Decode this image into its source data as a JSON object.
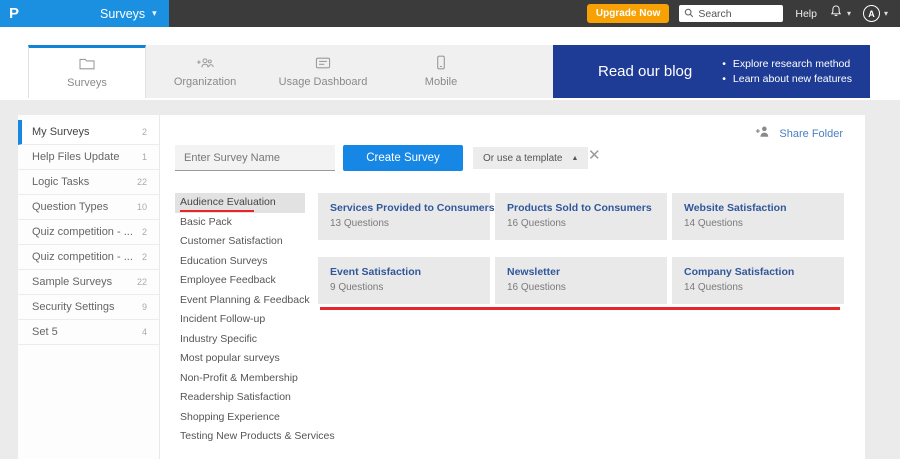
{
  "navbar": {
    "logo_letter": "P",
    "product_menu": "Surveys",
    "upgrade_label": "Upgrade Now",
    "search_placeholder": "Search",
    "help_label": "Help",
    "avatar_initial": "A"
  },
  "tabs": [
    {
      "label": "Surveys",
      "icon": "folder-icon"
    },
    {
      "label": "Organization",
      "icon": "people-add-icon"
    },
    {
      "label": "Usage Dashboard",
      "icon": "dashboard-card-icon"
    },
    {
      "label": "Mobile",
      "icon": "mobile-phone-icon"
    }
  ],
  "blog_banner": {
    "title": "Read our blog",
    "bullets": [
      "Explore research method",
      "Learn about new features"
    ]
  },
  "sidebar": {
    "items": [
      {
        "label": "My Surveys",
        "count": "2"
      },
      {
        "label": "Help Files Update",
        "count": "1"
      },
      {
        "label": "Logic Tasks",
        "count": "22"
      },
      {
        "label": "Question Types",
        "count": "10"
      },
      {
        "label": "Quiz competition - ...",
        "count": "2"
      },
      {
        "label": "Quiz competition - ...",
        "count": "2"
      },
      {
        "label": "Sample Surveys",
        "count": "22"
      },
      {
        "label": "Security Settings",
        "count": "9"
      },
      {
        "label": "Set 5",
        "count": "4"
      }
    ]
  },
  "main": {
    "share_folder_label": "Share Folder",
    "survey_name_placeholder": "Enter Survey Name",
    "create_button_label": "Create Survey",
    "template_dropdown_label": "Or use a template",
    "categories": [
      "Audience Evaluation",
      "Basic Pack",
      "Customer Satisfaction",
      "Education Surveys",
      "Employee Feedback",
      "Event Planning & Feedback",
      "Incident Follow-up",
      "Industry Specific",
      "Most popular surveys",
      "Non-Profit & Membership",
      "Readership Satisfaction",
      "Shopping Experience",
      "Testing New Products & Services"
    ],
    "active_category": "Audience Evaluation",
    "templates": [
      {
        "title": "Services Provided to Consumers",
        "questions": "13 Questions"
      },
      {
        "title": "Products Sold to Consumers",
        "questions": "16 Questions"
      },
      {
        "title": "Website Satisfaction",
        "questions": "14 Questions"
      },
      {
        "title": "Event Satisfaction",
        "questions": "9 Questions"
      },
      {
        "title": "Newsletter",
        "questions": "16 Questions"
      },
      {
        "title": "Company Satisfaction",
        "questions": "14 Questions"
      }
    ]
  },
  "icons": {
    "caret_down": "▾",
    "caret_up": "▲",
    "close": "✕"
  },
  "colors": {
    "navbar_bg": "#3b3b3b",
    "brand_blue": "#1b90e0",
    "button_blue": "#1787e6",
    "banner_navy": "#1e3c96",
    "upgrade_orange": "#f7a104",
    "annotation_red": "#e8262a",
    "active_tab_border": "#1084d8",
    "card_title_blue": "#31579b",
    "share_link_blue": "#4a7fc1"
  }
}
